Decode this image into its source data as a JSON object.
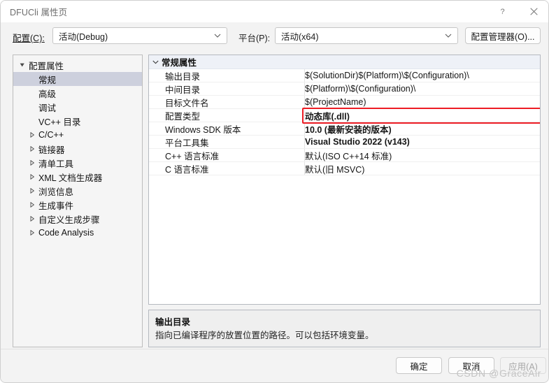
{
  "window": {
    "title": "DFUCli 属性页",
    "help_icon": "help-question-icon",
    "close_icon": "close-icon"
  },
  "toolbar": {
    "config_label": "配置(C):",
    "config_value": "活动(Debug)",
    "platform_label": "平台(P):",
    "platform_value": "活动(x64)",
    "config_manager_button": "配置管理器(O)..."
  },
  "sidebar": {
    "items": [
      {
        "label": "配置属性",
        "indent": 0,
        "twisty": "expanded",
        "selected": false
      },
      {
        "label": "常规",
        "indent": 1,
        "twisty": "none",
        "selected": true
      },
      {
        "label": "高级",
        "indent": 1,
        "twisty": "none",
        "selected": false
      },
      {
        "label": "调试",
        "indent": 1,
        "twisty": "none",
        "selected": false
      },
      {
        "label": "VC++ 目录",
        "indent": 1,
        "twisty": "none",
        "selected": false
      },
      {
        "label": "C/C++",
        "indent": 1,
        "twisty": "collapsed",
        "selected": false
      },
      {
        "label": "链接器",
        "indent": 1,
        "twisty": "collapsed",
        "selected": false
      },
      {
        "label": "清单工具",
        "indent": 1,
        "twisty": "collapsed",
        "selected": false
      },
      {
        "label": "XML 文档生成器",
        "indent": 1,
        "twisty": "collapsed",
        "selected": false
      },
      {
        "label": "浏览信息",
        "indent": 1,
        "twisty": "collapsed",
        "selected": false
      },
      {
        "label": "生成事件",
        "indent": 1,
        "twisty": "collapsed",
        "selected": false
      },
      {
        "label": "自定义生成步骤",
        "indent": 1,
        "twisty": "collapsed",
        "selected": false
      },
      {
        "label": "Code Analysis",
        "indent": 1,
        "twisty": "collapsed",
        "selected": false
      }
    ]
  },
  "grid": {
    "category": "常规属性",
    "rows": [
      {
        "name": "输出目录",
        "value": "$(SolutionDir)$(Platform)\\$(Configuration)\\",
        "bold": false,
        "highlighted": false
      },
      {
        "name": "中间目录",
        "value": "$(Platform)\\$(Configuration)\\",
        "bold": false,
        "highlighted": false
      },
      {
        "name": "目标文件名",
        "value": "$(ProjectName)",
        "bold": false,
        "highlighted": false
      },
      {
        "name": "配置类型",
        "value": "动态库(.dll)",
        "bold": true,
        "highlighted": true
      },
      {
        "name": "Windows SDK 版本",
        "value": "10.0 (最新安装的版本)",
        "bold": true,
        "highlighted": false
      },
      {
        "name": "平台工具集",
        "value": "Visual Studio 2022 (v143)",
        "bold": true,
        "highlighted": false
      },
      {
        "name": "C++ 语言标准",
        "value": "默认(ISO C++14 标准)",
        "bold": false,
        "highlighted": false
      },
      {
        "name": "C 语言标准",
        "value": "默认(旧 MSVC)",
        "bold": false,
        "highlighted": false
      }
    ]
  },
  "description": {
    "title": "输出目录",
    "text": "指向已编译程序的放置位置的路径。可以包括环境变量。"
  },
  "footer": {
    "ok_button": "确定",
    "cancel_button": "取消",
    "apply_button": "应用(A)",
    "apply_disabled": true
  },
  "watermark": "CSDN @GraceAir",
  "colors": {
    "highlight_red": "#ed1c24",
    "selection": "#cdd0dd",
    "category_header": "#eef1f7"
  }
}
